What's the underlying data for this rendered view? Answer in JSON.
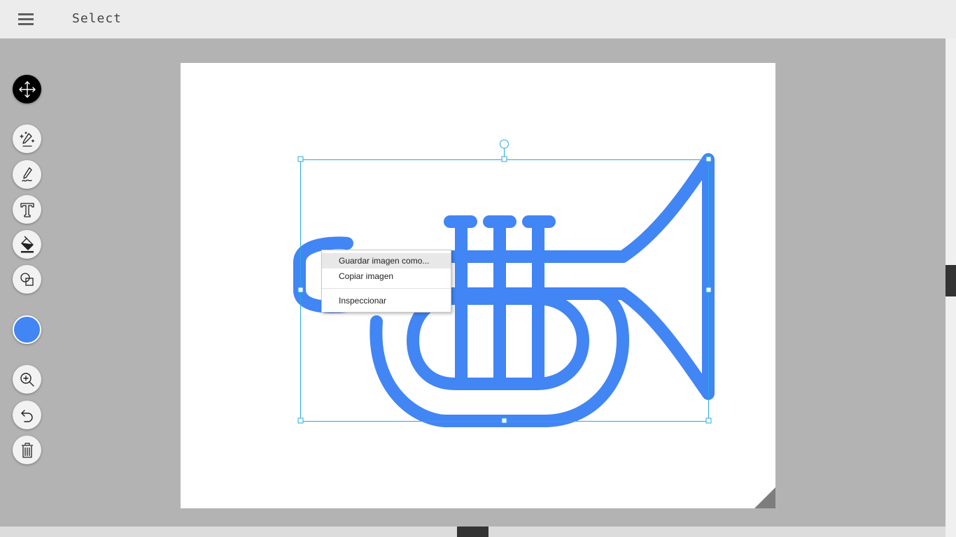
{
  "toolbar": {
    "title": "Select",
    "menu_icon": "hamburger-menu-icon"
  },
  "tools": [
    {
      "name": "move-tool",
      "icon": "move-arrows-icon",
      "active": true
    },
    {
      "name": "magic-draw-tool",
      "icon": "magic-pen-icon"
    },
    {
      "name": "pen-tool",
      "icon": "pen-icon"
    },
    {
      "name": "text-tool",
      "icon": "text-t-icon"
    },
    {
      "name": "fill-tool",
      "icon": "paint-bucket-icon"
    },
    {
      "name": "shape-tool",
      "icon": "shapes-icon"
    },
    {
      "name": "zoom-tool",
      "icon": "zoom-in-icon"
    },
    {
      "name": "undo-tool",
      "icon": "undo-icon"
    },
    {
      "name": "delete-tool",
      "icon": "trash-icon"
    }
  ],
  "colors": {
    "current_color": "#4285f4",
    "selection_color": "#29a8e0",
    "active_tool_bg": "#000000"
  },
  "canvas": {
    "drawing": "trumpet-illustration"
  },
  "context_menu": {
    "items": [
      {
        "label": "Guardar imagen como...",
        "hover": true
      },
      {
        "label": "Copiar imagen"
      },
      {
        "label": "Inspeccionar"
      }
    ]
  }
}
